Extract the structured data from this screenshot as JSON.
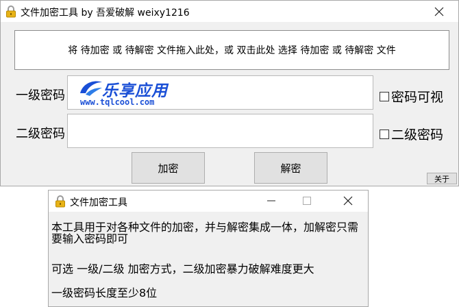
{
  "main_window": {
    "title": "文件加密工具 by 吾爱破解 weixy1216",
    "drop_zone_text": "将 待加密 或 待解密 文件拖入此处，或 双击此处 选择 待加密 或 待解密 文件",
    "level1_label": "一级密码",
    "level2_label": "二级密码",
    "level1_value": "",
    "level2_value": "",
    "show_password_label": "密码可视",
    "level2_checkbox_label": "二级密码",
    "encrypt_label": "加密",
    "decrypt_label": "解密",
    "about_label": "关于"
  },
  "watermark": {
    "name": "乐享应用",
    "url": "www.tqlcool.com"
  },
  "about_window": {
    "title": "文件加密工具",
    "line1": "本工具用于对各种文件的加密，并与解密集成一体，加解密只需要输入密码即可",
    "line2": "可选 一级/二级 加密方式，二级加密暴力破解难度更大",
    "line3": "一级密码长度至少8位"
  },
  "colors": {
    "watermark_blue": "#1a4fd6",
    "lock_gold": "#e8b317"
  },
  "icons": [
    "lock-icon",
    "close-icon",
    "maximize-icon",
    "minimize-icon",
    "checkbox-icon"
  ]
}
